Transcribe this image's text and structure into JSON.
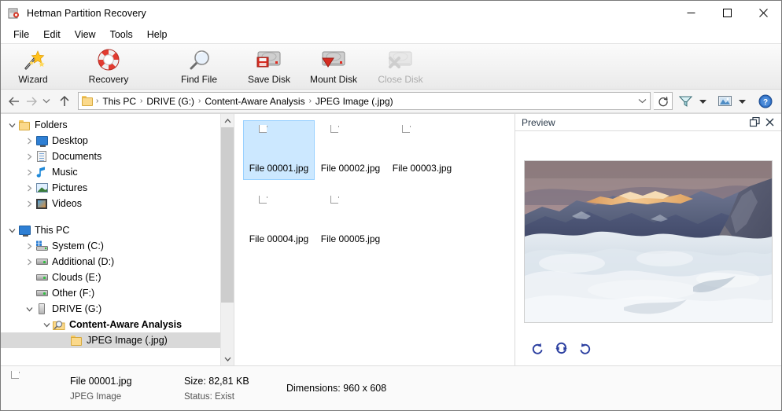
{
  "window": {
    "title": "Hetman Partition Recovery",
    "icon": "app-icon",
    "controls": {
      "minimize": "minimize",
      "maximize": "maximize",
      "close": "close"
    }
  },
  "menubar": {
    "items": [
      {
        "label": "File"
      },
      {
        "label": "Edit"
      },
      {
        "label": "View"
      },
      {
        "label": "Tools"
      },
      {
        "label": "Help"
      }
    ]
  },
  "toolbar": {
    "buttons": [
      {
        "label": "Wizard",
        "icon": "magic-wand-icon",
        "disabled": false
      },
      {
        "label": "Recovery",
        "icon": "lifebuoy-icon",
        "disabled": false
      },
      {
        "label": "Find File",
        "icon": "magnifier-icon",
        "disabled": false
      },
      {
        "label": "Save Disk",
        "icon": "save-disk-icon",
        "disabled": false
      },
      {
        "label": "Mount Disk",
        "icon": "mount-disk-icon",
        "disabled": false
      },
      {
        "label": "Close Disk",
        "icon": "close-disk-icon",
        "disabled": true
      }
    ]
  },
  "addressbar": {
    "back": "back-arrow-icon",
    "forward": "forward-arrow-icon",
    "history": "history-dropdown-icon",
    "up": "up-arrow-icon",
    "folder_icon": "folder-icon",
    "breadcrumbs": [
      {
        "label": "This PC"
      },
      {
        "label": "DRIVE (G:)"
      },
      {
        "label": "Content-Aware Analysis"
      },
      {
        "label": "JPEG Image (.jpg)"
      }
    ],
    "separator": "›",
    "dropdown": "chevron-down-icon",
    "refresh": "refresh-icon",
    "right_tools": [
      {
        "name": "filter-icon",
        "has_caret": true
      },
      {
        "name": "view-mode-icon",
        "has_caret": true
      },
      {
        "name": "help-icon",
        "has_caret": false
      }
    ]
  },
  "tree": {
    "groups": [
      {
        "root": {
          "label": "Folders",
          "icon": "folder-icon",
          "expander": "expanded",
          "indent": 0
        },
        "children": [
          {
            "label": "Desktop",
            "icon": "monitor-icon",
            "expander": "collapsed",
            "indent": 1
          },
          {
            "label": "Documents",
            "icon": "document-icon",
            "expander": "collapsed",
            "indent": 1
          },
          {
            "label": "Music",
            "icon": "music-note-icon",
            "expander": "collapsed",
            "indent": 1
          },
          {
            "label": "Pictures",
            "icon": "pictures-icon",
            "expander": "collapsed",
            "indent": 1
          },
          {
            "label": "Videos",
            "icon": "video-icon",
            "expander": "collapsed",
            "indent": 1
          }
        ]
      },
      {
        "root": {
          "label": "This PC",
          "icon": "computer-icon",
          "expander": "expanded",
          "indent": 0
        },
        "children": [
          {
            "label": "System (C:)",
            "icon": "system-drive-icon",
            "expander": "collapsed",
            "indent": 1
          },
          {
            "label": "Additional (D:)",
            "icon": "drive-icon",
            "expander": "collapsed",
            "indent": 1
          },
          {
            "label": "Clouds (E:)",
            "icon": "drive-icon",
            "expander": "none",
            "indent": 1
          },
          {
            "label": "Other (F:)",
            "icon": "drive-icon",
            "expander": "none",
            "indent": 1
          },
          {
            "label": "DRIVE (G:)",
            "icon": "usb-drive-icon",
            "expander": "expanded",
            "indent": 1
          },
          {
            "label": "Content-Aware Analysis",
            "icon": "magnifier-folder-icon",
            "expander": "expanded",
            "indent": 2,
            "bold": true
          },
          {
            "label": "JPEG Image (.jpg)",
            "icon": "folder-icon",
            "expander": "none",
            "indent": 3,
            "selected": true
          }
        ]
      }
    ],
    "scrollbar": {
      "up": "scroll-up-arrow",
      "down": "scroll-down-arrow",
      "thumb_top_pct": 0,
      "thumb_height_pct": 78
    }
  },
  "filelist": {
    "items": [
      {
        "name": "File 00001.jpg",
        "icon": "jpeg-file-icon",
        "selected": true
      },
      {
        "name": "File 00002.jpg",
        "icon": "jpeg-file-icon",
        "selected": false
      },
      {
        "name": "File 00003.jpg",
        "icon": "jpeg-file-icon",
        "selected": false
      },
      {
        "name": "File 00004.jpg",
        "icon": "jpeg-file-icon",
        "selected": false
      },
      {
        "name": "File 00005.jpg",
        "icon": "jpeg-file-icon",
        "selected": false
      }
    ]
  },
  "preview": {
    "title": "Preview",
    "undock_icon": "undock-icon",
    "close_icon": "close-icon",
    "image_alt": "Mountain range above a sea of clouds at sunset",
    "tools": [
      {
        "name": "rotate-left-icon"
      },
      {
        "name": "flip-icon"
      },
      {
        "name": "rotate-right-icon"
      }
    ]
  },
  "statusbar": {
    "icon": "jpeg-file-icon",
    "file_name": "File 00001.jpg",
    "file_type": "JPEG Image",
    "size_label": "Size:",
    "size_value": "82,81 KB",
    "status_label": "Status:",
    "status_value": "Exist",
    "dimensions_label": "Dimensions:",
    "dimensions_value": "960 x 608"
  },
  "colors": {
    "selection_blue": "#cce8ff",
    "tree_selection_gray": "#d9d9d9",
    "accent_red": "#cf2a2a",
    "link_blue": "#2a5db0"
  }
}
